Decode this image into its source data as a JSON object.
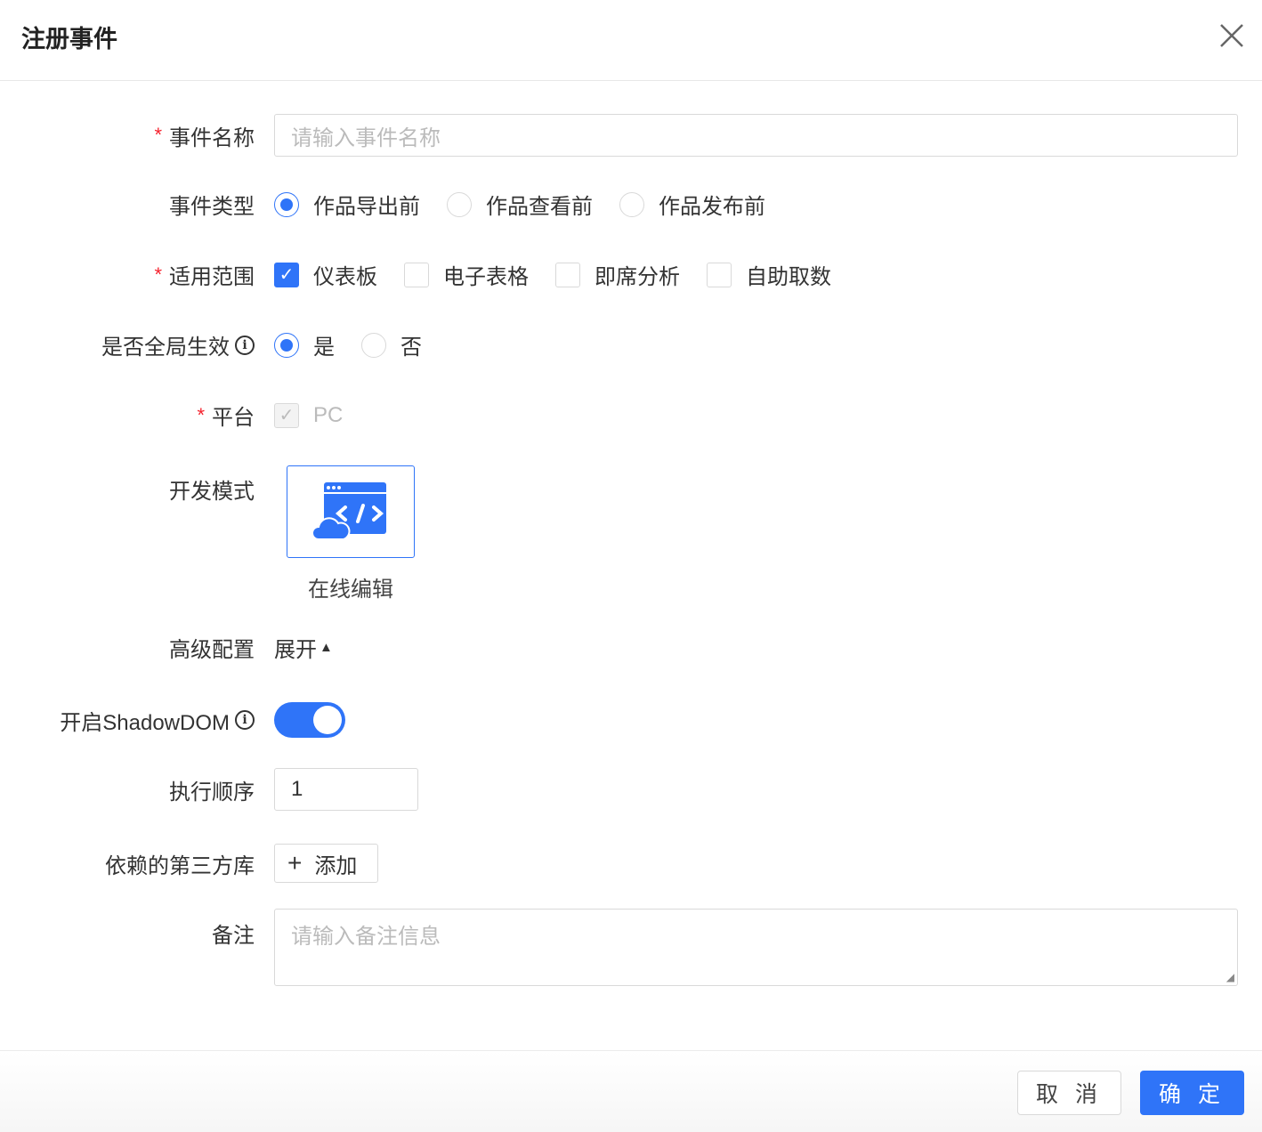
{
  "title": "注册事件",
  "form": {
    "name": {
      "label": "事件名称",
      "placeholder": "请输入事件名称"
    },
    "type": {
      "label": "事件类型",
      "options": [
        "作品导出前",
        "作品查看前",
        "作品发布前"
      ],
      "selected": 0
    },
    "scope": {
      "label": "适用范围",
      "options": [
        "仪表板",
        "电子表格",
        "即席分析",
        "自助取数"
      ],
      "checked": [
        true,
        false,
        false,
        false
      ]
    },
    "global": {
      "label": "是否全局生效",
      "options": [
        "是",
        "否"
      ],
      "selected": 0
    },
    "platform": {
      "label": "平台",
      "option": "PC"
    },
    "devmode": {
      "label": "开发模式",
      "option": "在线编辑"
    },
    "advanced": {
      "label": "高级配置",
      "toggle": "展开"
    },
    "shadow": {
      "label": "开启ShadowDOM",
      "on": true
    },
    "order": {
      "label": "执行顺序",
      "value": "1"
    },
    "deps": {
      "label": "依赖的第三方库",
      "add": "添加"
    },
    "remark": {
      "label": "备注",
      "placeholder": "请输入备注信息"
    }
  },
  "footer": {
    "cancel": "取 消",
    "ok": "确 定"
  },
  "colors": {
    "primary": "#2f74f8",
    "required": "#f5222d"
  }
}
